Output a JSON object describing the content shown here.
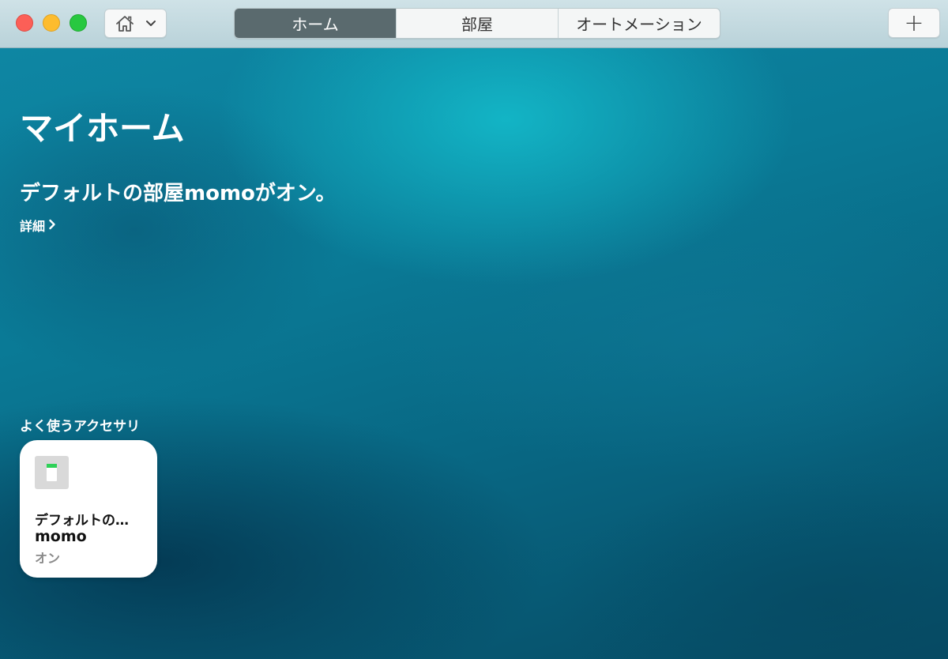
{
  "toolbar": {
    "home_menu_icon": "house-icon",
    "home_menu_chevron": "chevron-down-icon",
    "tabs": [
      {
        "label": "ホーム",
        "selected": true
      },
      {
        "label": "部屋",
        "selected": false
      },
      {
        "label": "オートメーション",
        "selected": false
      }
    ],
    "add_label": "+"
  },
  "main": {
    "title": "マイホーム",
    "status": "デフォルトの部屋momoがオン。",
    "details_label": "詳細",
    "details_icon": "chevron-right-icon",
    "favorites_header": "よく使うアクセサリ",
    "accessories": [
      {
        "icon": "switch-icon",
        "room": "デフォルトの…",
        "name": "momo",
        "state": "オン"
      }
    ]
  },
  "colors": {
    "close": "#fc5f57",
    "minimize": "#fdbc2e",
    "zoom": "#28c840",
    "active_tab": "#5a6a6e",
    "switch_on": "#2fd158"
  }
}
